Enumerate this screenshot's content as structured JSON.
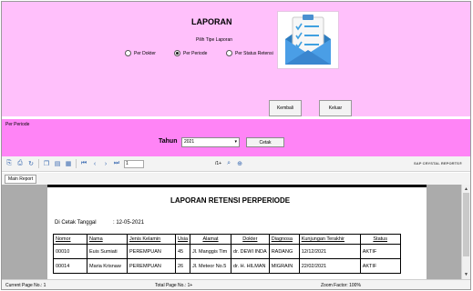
{
  "header": {
    "title": "LAPORAN",
    "type_label": "Pilih Tipe Laporan",
    "radios": [
      {
        "label": "Per Dokter",
        "checked": false
      },
      {
        "label": "Per Periode",
        "checked": true
      },
      {
        "label": "Per Status Retensi",
        "checked": false
      }
    ],
    "illustration_icon": "clipboard-envelope-icon",
    "back_label": "Kembali",
    "exit_label": "Keluar"
  },
  "filter": {
    "caption": "Per Periode",
    "year_label": "Tahun",
    "year_value": "2021",
    "print_label": "Cetak"
  },
  "viewer": {
    "page_value": "1",
    "page_total": "/1+",
    "brand": "SAP CRYSTAL REPORTS®",
    "tab_label": "Main Report"
  },
  "report": {
    "title": "LAPORAN RETENSI PERPERIODE",
    "print_date_label": "Di Cetak Tanggal",
    "print_date_value": ": 12-05-2021",
    "columns": [
      "Nomor",
      "Nama",
      "Jenis Kelamin",
      "Usia",
      "Alamat",
      "Dokter",
      "Diagnosa",
      "Kunjungan Terakhir",
      "Status"
    ],
    "rows": [
      [
        "00010",
        "Euis Sumiati",
        "PEREMPUAN",
        "45",
        "Jl. Manggis Tim",
        "dr. DEWI INDA",
        "RADANG",
        "12/12/2021",
        "AKTIF"
      ],
      [
        "00014",
        "Maria Krisnaw",
        "PEREMPUAN",
        "26",
        "Jl. Meteor No.5",
        "dr. H. HILMAN",
        "MIGRAIN",
        "22/02/2021",
        "AKTIF"
      ]
    ]
  },
  "status": {
    "current_page": "Current Page No.: 1",
    "total_page": "Total Page No.: 1+",
    "zoom": "Zoom Factor: 100%"
  },
  "colors": {
    "top_panel": "#ffc0fb",
    "filter_bar": "#ff84f6"
  }
}
